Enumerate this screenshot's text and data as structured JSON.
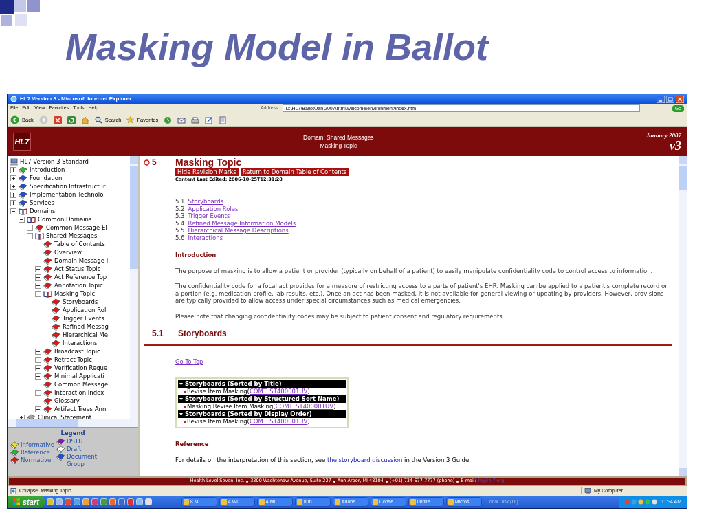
{
  "slide_title": "Masking Model in Ballot",
  "window": {
    "title": "HL7 Version 3 - Microsoft Internet Explorer"
  },
  "menu": [
    "File",
    "Edit",
    "View",
    "Favorites",
    "Tools",
    "Help"
  ],
  "address": {
    "label": "Address",
    "value": "D:\\HL7\\Ballot\\Jan 2007\\html\\welcome\\environment\\index.htm",
    "go": "Go"
  },
  "toolbar": {
    "back": "Back",
    "search": "Search",
    "favorites": "Favorites"
  },
  "banner": {
    "logo": "HL7",
    "domain": "Domain: Shared Messages",
    "topic": "Masking Topic",
    "date": "January 2007",
    "version": "v3"
  },
  "tree_root": "HL7 Version 3 Standard",
  "tree": [
    {
      "label": "Introduction",
      "kind": "branch",
      "expanded": false,
      "color": "#33b233"
    },
    {
      "label": "Foundation",
      "kind": "branch",
      "expanded": false,
      "color": "#1f4fd6"
    },
    {
      "label": "Specification Infrastructur",
      "kind": "branch",
      "expanded": false,
      "color": "#1f4fd6"
    },
    {
      "label": "Implementation Technolo",
      "kind": "branch",
      "expanded": false,
      "color": "#1f4fd6"
    },
    {
      "label": "Services",
      "kind": "branch",
      "expanded": false,
      "color": "#1f4fd6"
    },
    {
      "label": "Domains",
      "kind": "branch",
      "expanded": true,
      "children": [
        {
          "label": "Common Domains",
          "kind": "branch",
          "expanded": true,
          "children": [
            {
              "label": "Common Message El",
              "kind": "branch",
              "expanded": false,
              "color": "#d91a1a"
            },
            {
              "label": "Shared Messages",
              "kind": "branch",
              "expanded": true,
              "children": [
                {
                  "label": "Table of Contents",
                  "kind": "leaf",
                  "color": "#d91a1a"
                },
                {
                  "label": "Overview",
                  "kind": "leaf",
                  "color": "#d91a1a"
                },
                {
                  "label": "Domain Message I",
                  "kind": "leaf",
                  "color": "#d91a1a"
                },
                {
                  "label": "Act Status Topic",
                  "kind": "branch",
                  "expanded": false,
                  "color": "#d91a1a"
                },
                {
                  "label": "Act Reference Top",
                  "kind": "branch",
                  "expanded": false,
                  "color": "#d91a1a"
                },
                {
                  "label": "Annotation Topic",
                  "kind": "branch",
                  "expanded": false,
                  "color": "#d91a1a"
                },
                {
                  "label": "Masking Topic",
                  "kind": "branch",
                  "expanded": true,
                  "children": [
                    {
                      "label": "Storyboards",
                      "kind": "leaf",
                      "color": "#d91a1a"
                    },
                    {
                      "label": "Application Rol",
                      "kind": "leaf",
                      "color": "#d91a1a"
                    },
                    {
                      "label": "Trigger Events",
                      "kind": "leaf",
                      "color": "#d91a1a"
                    },
                    {
                      "label": "Refined Messag",
                      "kind": "leaf",
                      "color": "#d91a1a"
                    },
                    {
                      "label": "Hierarchical Me",
                      "kind": "leaf",
                      "color": "#d91a1a"
                    },
                    {
                      "label": "Interactions",
                      "kind": "leaf",
                      "color": "#d91a1a"
                    }
                  ]
                },
                {
                  "label": "Broadcast Topic",
                  "kind": "branch",
                  "expanded": false,
                  "color": "#d91a1a"
                },
                {
                  "label": "Retract Topic",
                  "kind": "branch",
                  "expanded": false,
                  "color": "#d91a1a"
                },
                {
                  "label": "Verification Reque",
                  "kind": "branch",
                  "expanded": false,
                  "color": "#d91a1a"
                },
                {
                  "label": "Minimal Applicati",
                  "kind": "branch",
                  "expanded": false,
                  "color": "#d91a1a"
                },
                {
                  "label": "Common Message",
                  "kind": "leaf",
                  "color": "#d91a1a"
                },
                {
                  "label": "Interaction Index",
                  "kind": "branch",
                  "expanded": false,
                  "color": "#d91a1a"
                },
                {
                  "label": "Glossary",
                  "kind": "leaf",
                  "color": "#d91a1a"
                },
                {
                  "label": "Artifact Trees Ann",
                  "kind": "branch",
                  "expanded": false,
                  "color": "#d91a1a"
                }
              ]
            }
          ]
        },
        {
          "label": "Clinical Statement",
          "kind": "branch",
          "expanded": false,
          "color": "#a3a3a3"
        }
      ]
    }
  ],
  "legend": {
    "title": "Legend",
    "columns": [
      [
        {
          "label": "Informative",
          "color": "#e8e020"
        },
        {
          "label": "Reference",
          "color": "#33b233"
        },
        {
          "label": "Normative",
          "color": "#d91a1a"
        }
      ],
      [
        {
          "label": "DSTU",
          "color": "#7a1fa2"
        },
        {
          "label": "Draft",
          "color": "#ffffff"
        },
        {
          "label": "Document Group",
          "color": "#1f4fd6"
        }
      ]
    ]
  },
  "content": {
    "section": {
      "number": "5",
      "title": "Masking Topic"
    },
    "buttons": [
      "Hide Revision Marks",
      "Return to Domain Table of Contents"
    ],
    "edited": "Content Last Edited: 2006-10-25T12:31:28",
    "toc": [
      {
        "number": "5.1",
        "link": "Storyboards"
      },
      {
        "number": "5.2",
        "link": "Application Roles"
      },
      {
        "number": "5.3",
        "link": "Trigger Events"
      },
      {
        "number": "5.4",
        "link": "Refined Message Information Models"
      },
      {
        "number": "5.5",
        "link": "Hierarchical Message Descriptions"
      },
      {
        "number": "5.6",
        "link": "Interactions"
      }
    ],
    "intro_heading": "Introduction",
    "paragraphs": [
      "The purpose of masking is to allow a patient or provider (typically on behalf of a patient) to easily manipulate confidentiality code to control access to information.",
      "The confidentiality code for a focal act provides for a measure of restricting access to a parts of patient's EHR. Masking can be applied to a patient's complete record or a portion (e.g. medication profile, lab results, etc.). Once an act has been masked, it is not available for general viewing or updating by providers. However, provisions are typically provided to allow access under special circumstances such as medical emergencies.",
      "Please note that changing confidentiality codes may be subject to patient consent and regulatory requirements."
    ],
    "subsection": {
      "number": "5.1",
      "title": "Storyboards"
    },
    "go_top": "Go To Top",
    "storyboard_groups": [
      {
        "heading": "Storyboards (Sorted by Title)",
        "entries": [
          {
            "text": "Revise Item Masking(",
            "code": "COMT_ST400001UV",
            "after": ")"
          }
        ]
      },
      {
        "heading": "Storyboards (Sorted by Structured Sort Name)",
        "entries": [
          {
            "text": "Masking Revise Item Masking(",
            "code": "COMT_ST400001UV",
            "after": ")"
          }
        ]
      },
      {
        "heading": "Storyboards (Sorted by Display Order)",
        "entries": [
          {
            "text": "Revise Item Masking(",
            "code": "COMT_ST400001UV",
            "after": ")"
          }
        ]
      }
    ],
    "reference_heading": "Reference",
    "reference": {
      "before": "For details on the interpretation of this section, see ",
      "link": "the storyboard discussion",
      "after": " in the Version 3 Guide."
    }
  },
  "footer": {
    "parts": [
      "Health Level Seven, Inc.",
      "3300 Washtenaw Avenue, Suite 227",
      "Ann Arbor, MI 48104",
      "(+01) 734-677-7777 (phone)",
      "E-mail:"
    ],
    "email": "hq@hl7.org"
  },
  "status_bar": {
    "text": "Collapse  Masking Topic",
    "zone": "My Computer"
  },
  "taskbar": {
    "start": "start",
    "tasks": [
      "8 Mi...",
      "4 Wi...",
      "4 Mi...",
      "8 In...",
      "Adobe...",
      "Conse...",
      "untitle...",
      "Micros..."
    ],
    "drive": "Local Disk (D:)",
    "clock": "11:34 AM"
  }
}
